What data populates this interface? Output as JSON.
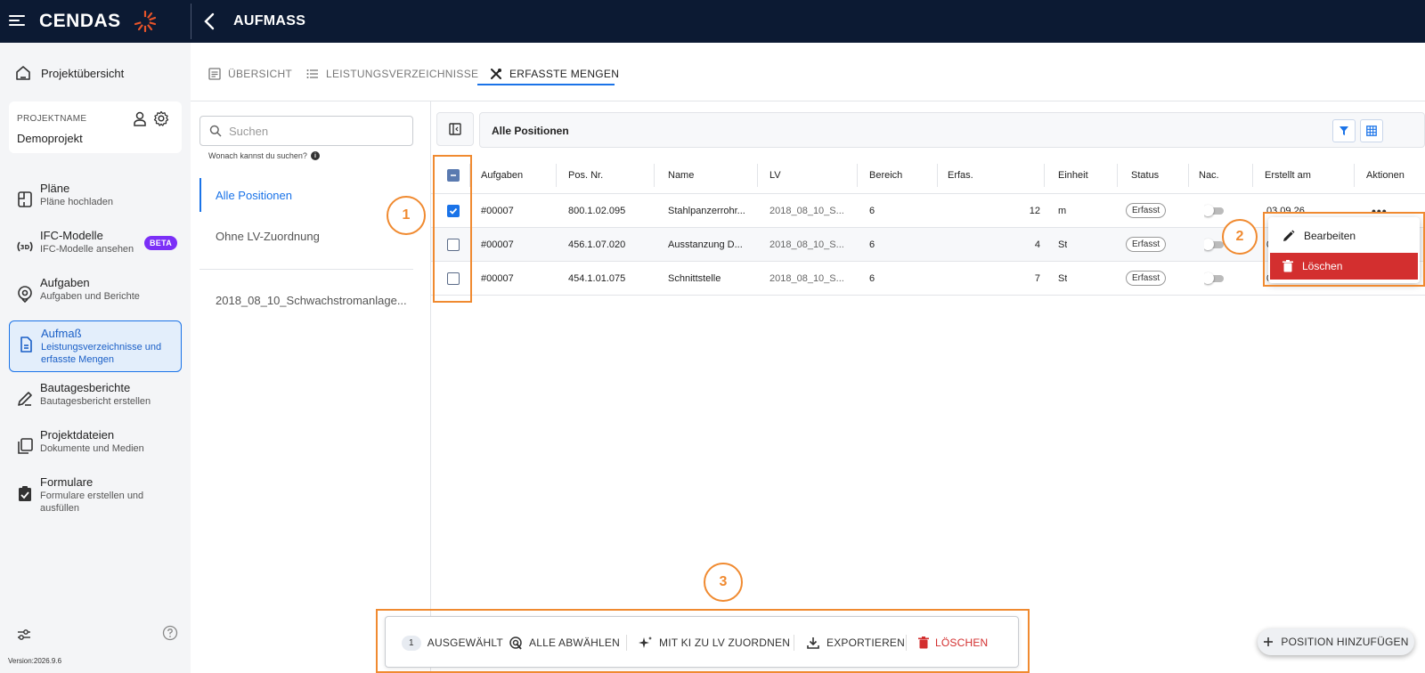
{
  "app": {
    "logo": "CENDAS",
    "page_title": "AUFMASS"
  },
  "sidebar": {
    "home_label": "Projektübersicht",
    "project_label": "PROJEKTNAME",
    "project_name": "Demoprojekt",
    "items": [
      {
        "title": "Pläne",
        "sub": "Pläne hochladen"
      },
      {
        "title": "IFC-Modelle",
        "sub": "IFC-Modelle ansehen",
        "badge": "BETA"
      },
      {
        "title": "Aufgaben",
        "sub": "Aufgaben und Berichte"
      },
      {
        "title": "Aufmaß",
        "sub": "Leistungsverzeichnisse und erfasste Mengen"
      },
      {
        "title": "Bautagesberichte",
        "sub": "Bautagesbericht erstellen"
      },
      {
        "title": "Projektdateien",
        "sub": "Dokumente und Medien"
      },
      {
        "title": "Formulare",
        "sub": "Formulare erstellen und ausfüllen"
      }
    ],
    "active_index": 3,
    "version": "Version:2026.9.6"
  },
  "tabs": [
    {
      "label": "ÜBERSICHT"
    },
    {
      "label": "LEISTUNGSVERZEICHNISSE"
    },
    {
      "label": "ERFASSTE MENGEN"
    }
  ],
  "filter": {
    "search_placeholder": "Suchen",
    "search_hint": "Wonach kannst du suchen?",
    "items": [
      "Alle Positionen",
      "Ohne LV-Zuordnung"
    ],
    "lv_items": [
      "2018_08_10_Schwachstromanlage..."
    ]
  },
  "main": {
    "header_title": "Alle Positionen",
    "columns": [
      "Aufgaben",
      "Pos. Nr.",
      "Name",
      "LV",
      "Bereich",
      "Erfas.",
      "Einheit",
      "Status",
      "Nac.",
      "Erstellt am",
      "Aktionen"
    ],
    "rows": [
      {
        "checked": true,
        "aufgaben": "#00007",
        "pos": "800.1.02.095",
        "name": "Stahlpanzerrohr...",
        "lv": "2018_08_10_S...",
        "bereich": "6",
        "erfasst": "12",
        "einheit": "m",
        "status": "Erfasst",
        "erstellt": "03.09.26"
      },
      {
        "checked": false,
        "aufgaben": "#00007",
        "pos": "456.1.07.020",
        "name": "Ausstanzung D...",
        "lv": "2018_08_10_S...",
        "bereich": "6",
        "erfasst": "4",
        "einheit": "St",
        "status": "Erfasst",
        "erstellt": "0"
      },
      {
        "checked": false,
        "aufgaben": "#00007",
        "pos": "454.1.01.075",
        "name": "Schnittstelle",
        "lv": "2018_08_10_S...",
        "bereich": "6",
        "erfasst": "7",
        "einheit": "St",
        "status": "Erfasst",
        "erstellt": "03.09.26"
      }
    ]
  },
  "context_menu": {
    "edit_label": "Bearbeiten",
    "delete_label": "Löschen"
  },
  "annotations": [
    "1",
    "2",
    "3"
  ],
  "action_bar": {
    "count": "1",
    "selected_label": "AUSGEWÄHLT",
    "deselect_label": "ALLE ABWÄHLEN",
    "ai_label": "MIT KI ZU LV ZUORDNEN",
    "export_label": "EXPORTIEREN",
    "delete_label": "LÖSCHEN"
  },
  "fab_label": "POSITION HINZUFÜGEN",
  "colors": {
    "topbar": "#0c1a33",
    "accent": "#1a73e8",
    "annotation": "#f08a30",
    "danger": "#d32f2f",
    "beta": "#7b2ff7"
  }
}
